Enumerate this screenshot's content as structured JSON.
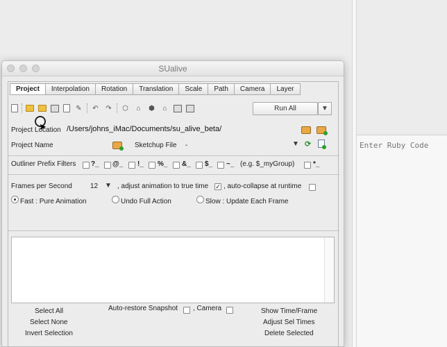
{
  "window": {
    "title": "SUalive"
  },
  "tabs": [
    "Project",
    "Interpolation",
    "Rotation",
    "Translation",
    "Scale",
    "Path",
    "Camera",
    "Layer"
  ],
  "toolbar": {
    "icons": [
      "new-file-icon",
      "open-folder-icon",
      "save-icon",
      "save-as-icon",
      "copy-icon",
      "edit-icon",
      "undo-icon",
      "redo-icon",
      "component-icon",
      "house-icon",
      "bell-icon",
      "home-icon",
      "image-icon",
      "mail-icon"
    ],
    "run_label": "Run All",
    "run_menu": "▼"
  },
  "project": {
    "location_label": "Project Location",
    "location_value": "/Users/johns_iMac/Documents/su_alive_beta/",
    "name_label": "Project Name",
    "sketchup_label": "Sketchup File",
    "sketchup_value": "-",
    "filters_label": "Outliner Prefix Filters",
    "filters": [
      "?_",
      "@_",
      "!_",
      "%_",
      "&_",
      "$_",
      "~_"
    ],
    "filters_example": "(e.g. $_myGroup)",
    "filter_extra": "*_"
  },
  "frames": {
    "fps_label": "Frames per Second",
    "fps_value": "12",
    "fps_menu": "▼",
    "adjust_label": ", adjust animation to true time",
    "adjust_checked": "✓",
    "autocollapse_label": ", auto-collapse at runtime"
  },
  "modes": [
    {
      "label": "Fast : Pure Animation",
      "selected": true
    },
    {
      "label": "Undo Full Action",
      "selected": false
    },
    {
      "label": "Slow : Update Each Frame",
      "selected": false
    }
  ],
  "footer": {
    "select_all": "Select All",
    "select_none": "Select None",
    "invert": "Invert Selection",
    "autorestore": "Auto-restore Snapshot",
    "camera": ", Camera",
    "show_time": "Show Time/Frame",
    "adjust_times": "Adjust Sel Times",
    "delete_sel": "Delete Selected"
  },
  "ruby_console": {
    "placeholder": "Enter Ruby Code"
  },
  "colors": {
    "folder": "#f0c040",
    "accent_green": "#2f9e2f",
    "window_bg": "#ececec"
  }
}
